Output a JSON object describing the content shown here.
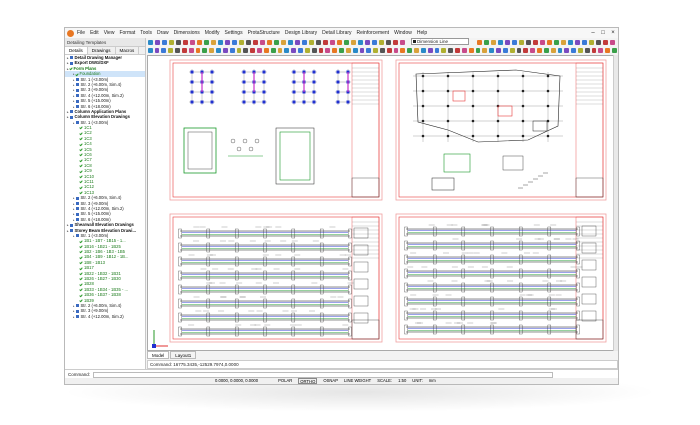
{
  "menu": [
    "File",
    "Edit",
    "View",
    "Format",
    "Tools",
    "Draw",
    "Dimensions",
    "Modify",
    "Settings",
    "ProtaStructure",
    "Design Library",
    "Detail Library",
    "Reinforcement",
    "Window",
    "Help"
  ],
  "toolbar": {
    "dimension_style": "Dimension Line"
  },
  "left_panel": {
    "title": "Detailing Templates",
    "tabs": [
      {
        "label": "Details",
        "active": true
      },
      {
        "label": "Drawings",
        "active": false
      },
      {
        "label": "Macros",
        "active": false
      }
    ],
    "tree": [
      {
        "label": "Detail Drawing Manager",
        "indent": 0,
        "type": "blue",
        "bold": true
      },
      {
        "label": "Export DWG/DXF",
        "indent": 0,
        "type": "blue",
        "bold": true
      },
      {
        "label": "Form Plans",
        "indent": 0,
        "type": "green",
        "bold": true
      },
      {
        "label": "Foundation",
        "indent": 2,
        "type": "green",
        "bold": false,
        "selected": true
      },
      {
        "label": "Str. 1 (+3.00m)",
        "indent": 2,
        "type": "blue",
        "bold": false
      },
      {
        "label": "Str. 2 (+6.00m, Sim.4)",
        "indent": 2,
        "type": "blue",
        "bold": false
      },
      {
        "label": "Str. 3 (+9.00m)",
        "indent": 2,
        "type": "blue",
        "bold": false
      },
      {
        "label": "Str. 4 (+12.00m, Sim.2)",
        "indent": 2,
        "type": "blue",
        "bold": false
      },
      {
        "label": "Str. 5 (+15.00m)",
        "indent": 2,
        "type": "blue",
        "bold": false
      },
      {
        "label": "Str. 6 (+18.00m)",
        "indent": 2,
        "type": "blue",
        "bold": false
      },
      {
        "label": "Column Application Plans",
        "indent": 0,
        "type": "blue",
        "bold": true
      },
      {
        "label": "Column Elevation Drawings",
        "indent": 0,
        "type": "blue",
        "bold": true
      },
      {
        "label": "Str. 1 (+3.00m)",
        "indent": 2,
        "type": "blue",
        "bold": false
      },
      {
        "label": "1C1",
        "indent": 4,
        "type": "green",
        "bold": false
      },
      {
        "label": "1C2",
        "indent": 4,
        "type": "green",
        "bold": false
      },
      {
        "label": "1C3",
        "indent": 4,
        "type": "green",
        "bold": false
      },
      {
        "label": "1C4",
        "indent": 4,
        "type": "green",
        "bold": false
      },
      {
        "label": "1C5",
        "indent": 4,
        "type": "green",
        "bold": false
      },
      {
        "label": "1C6",
        "indent": 4,
        "type": "green",
        "bold": false
      },
      {
        "label": "1C7",
        "indent": 4,
        "type": "green",
        "bold": false
      },
      {
        "label": "1C8",
        "indent": 4,
        "type": "green",
        "bold": false
      },
      {
        "label": "1C9",
        "indent": 4,
        "type": "green",
        "bold": false
      },
      {
        "label": "1C10",
        "indent": 4,
        "type": "green",
        "bold": false
      },
      {
        "label": "1C11",
        "indent": 4,
        "type": "green",
        "bold": false
      },
      {
        "label": "1C12",
        "indent": 4,
        "type": "green",
        "bold": false
      },
      {
        "label": "1C13",
        "indent": 4,
        "type": "green",
        "bold": false
      },
      {
        "label": "Str. 2 (+6.00m, Sim.4)",
        "indent": 2,
        "type": "blue",
        "bold": false
      },
      {
        "label": "Str. 3 (+9.00m)",
        "indent": 2,
        "type": "blue",
        "bold": false
      },
      {
        "label": "Str. 4 (+12.00m, Sim.2)",
        "indent": 2,
        "type": "blue",
        "bold": false
      },
      {
        "label": "Str. 5 (+15.00m)",
        "indent": 2,
        "type": "blue",
        "bold": false
      },
      {
        "label": "Str. 6 (+18.00m)",
        "indent": 2,
        "type": "blue",
        "bold": false
      },
      {
        "label": "Shearwall Elevation Drawings",
        "indent": 0,
        "type": "blue",
        "bold": true
      },
      {
        "label": "Storey Beam Elevation Drawi...",
        "indent": 0,
        "type": "blue",
        "bold": true
      },
      {
        "label": "Str. 1 (+3.00m)",
        "indent": 2,
        "type": "blue",
        "bold": false
      },
      {
        "label": "1B1 - 1B7 - 1B15 - 1...",
        "indent": 4,
        "type": "green",
        "bold": false
      },
      {
        "label": "1B16 - 1B21 - 1B25",
        "indent": 4,
        "type": "green",
        "bold": false
      },
      {
        "label": "1B2 - 1B6 - 1B3 - 1B5",
        "indent": 4,
        "type": "green",
        "bold": false
      },
      {
        "label": "1B4 - 1B9 - 1B12 - 1B...",
        "indent": 4,
        "type": "green",
        "bold": false
      },
      {
        "label": "1B8 - 1B13",
        "indent": 4,
        "type": "green",
        "bold": false
      },
      {
        "label": "1B17",
        "indent": 4,
        "type": "green",
        "bold": false
      },
      {
        "label": "1B22 - 1B32 - 1B31",
        "indent": 4,
        "type": "green",
        "bold": false
      },
      {
        "label": "1B26 - 1B27 - 1B30",
        "indent": 4,
        "type": "green",
        "bold": false
      },
      {
        "label": "1B28",
        "indent": 4,
        "type": "green",
        "bold": false
      },
      {
        "label": "1B33 - 1B34 - 1B35 - ...",
        "indent": 4,
        "type": "green",
        "bold": false
      },
      {
        "label": "1B36 - 1B37 - 1B38",
        "indent": 4,
        "type": "green",
        "bold": false
      },
      {
        "label": "1B39",
        "indent": 4,
        "type": "green",
        "bold": false
      },
      {
        "label": "Str. 2 (+6.00m, Sim.4)",
        "indent": 2,
        "type": "blue",
        "bold": false
      },
      {
        "label": "Str. 3 (+9.00m)",
        "indent": 2,
        "type": "blue",
        "bold": false
      },
      {
        "label": "Str. 4 (+12.00m, Sim.2)",
        "indent": 2,
        "type": "blue",
        "bold": false
      }
    ]
  },
  "model_tabs": [
    {
      "label": "Model",
      "active": true
    },
    {
      "label": "Layout1",
      "active": false
    }
  ],
  "command_history": "Command: 16775.3435,-12529.7974,0.0000",
  "command_label": "Command:",
  "status": {
    "coords": "0.0000, 0.0000, 0.0000",
    "toggles": [
      {
        "label": "POLAR",
        "on": false
      },
      {
        "label": "ORTHO",
        "on": true
      },
      {
        "label": "OSNAP",
        "on": false
      },
      {
        "label": "LINE WEIGHT",
        "on": false
      },
      {
        "label": "SCALE:",
        "on": false
      },
      {
        "label": "1:50",
        "on": false
      },
      {
        "label": "UNIT:",
        "on": false
      },
      {
        "label": "mm",
        "on": false
      }
    ]
  },
  "colors": {
    "accent": "#e87722",
    "sheet_border": "#e83b3b",
    "rebar_blue": "#2030d0",
    "rebar_green": "#1a9a2a",
    "magenta": "#c832c8"
  }
}
